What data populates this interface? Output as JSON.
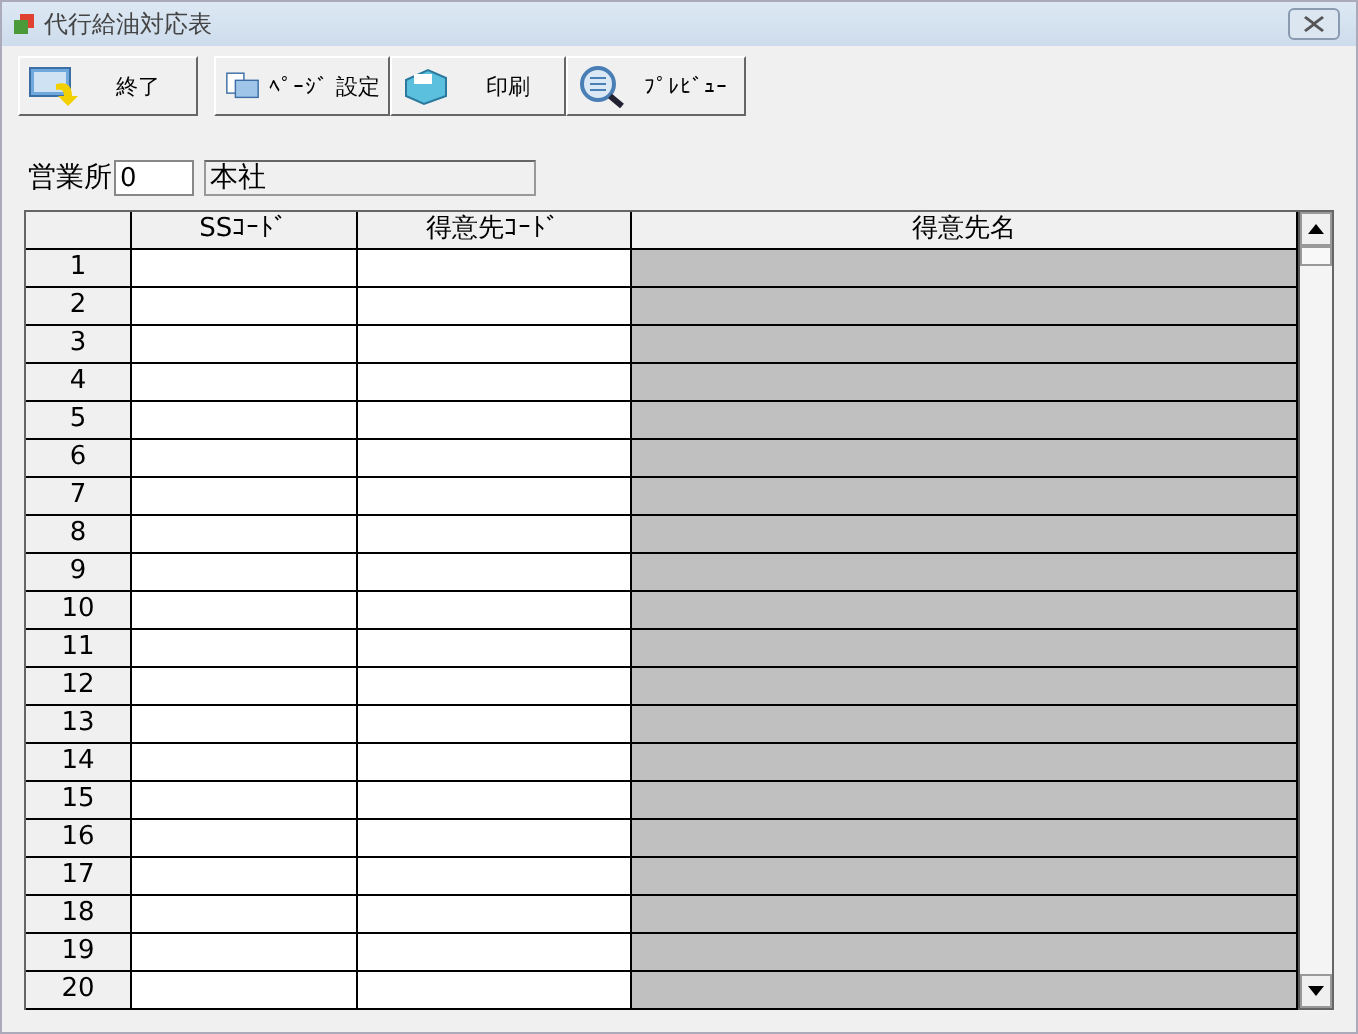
{
  "window": {
    "title": "代行給油対応表"
  },
  "toolbar": [
    {
      "label": "終了",
      "kind": "exit"
    },
    {
      "label": "ﾍﾟｰｼﾞ 設定",
      "kind": "page"
    },
    {
      "label": "印刷",
      "kind": "print"
    },
    {
      "label": "ﾌﾟﾚﾋﾞｭｰ",
      "kind": "preview"
    }
  ],
  "office": {
    "label": "営業所",
    "code": "0",
    "name": "本社"
  },
  "table": {
    "columns": [
      {
        "label": "SSｺｰﾄﾞ",
        "readonly": false
      },
      {
        "label": "得意先ｺｰﾄﾞ",
        "readonly": false
      },
      {
        "label": "得意先名",
        "readonly": true
      }
    ],
    "rows": [
      {
        "number": "1"
      },
      {
        "number": "2"
      },
      {
        "number": "3"
      },
      {
        "number": "4"
      },
      {
        "number": "5"
      },
      {
        "number": "6"
      },
      {
        "number": "7"
      },
      {
        "number": "8"
      },
      {
        "number": "9"
      },
      {
        "number": "10"
      },
      {
        "number": "11"
      },
      {
        "number": "12"
      },
      {
        "number": "13"
      },
      {
        "number": "14"
      },
      {
        "number": "15"
      },
      {
        "number": "16"
      },
      {
        "number": "17"
      },
      {
        "number": "18"
      },
      {
        "number": "19"
      },
      {
        "number": "20"
      }
    ]
  }
}
